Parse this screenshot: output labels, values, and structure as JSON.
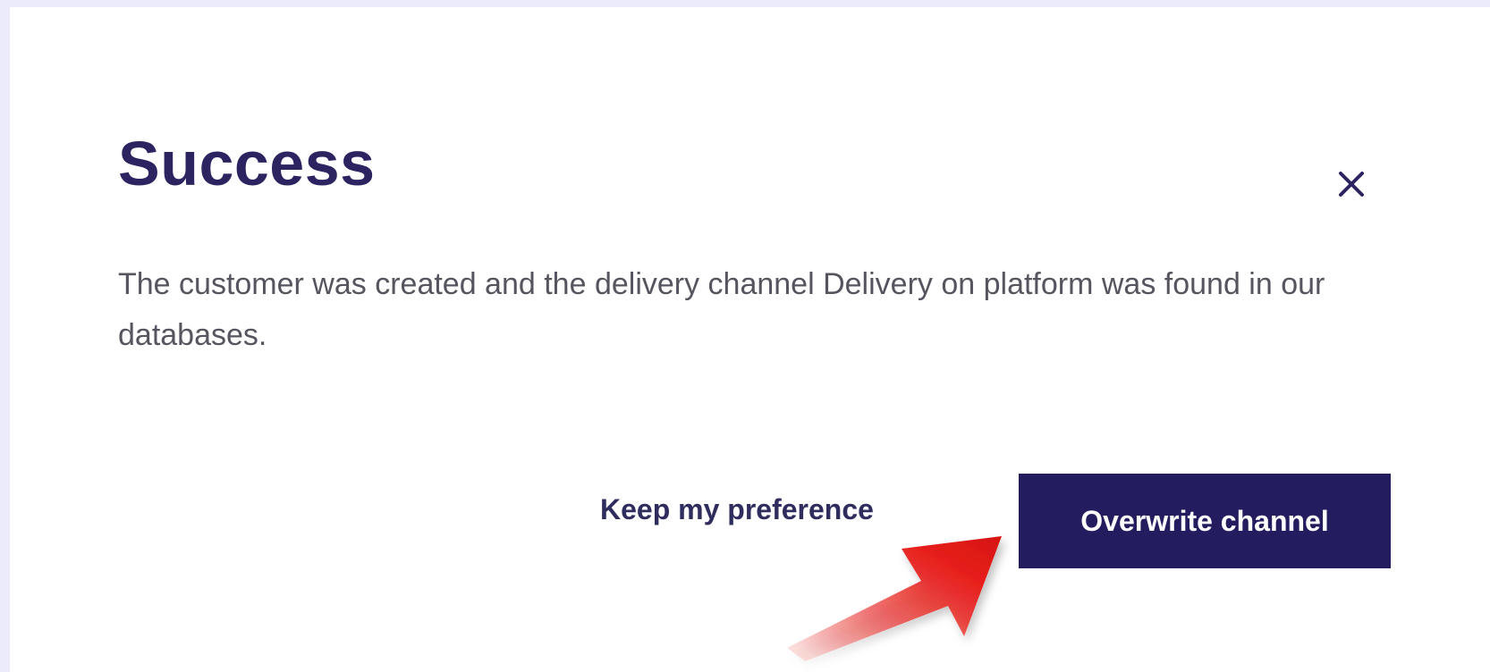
{
  "dialog": {
    "title": "Success",
    "message": "The customer was created and the delivery channel Delivery on platform was found in our databases.",
    "close_icon": "close-icon",
    "secondary_action_label": "Keep my preference",
    "primary_action_label": "Overwrite channel"
  },
  "annotation": {
    "icon": "red-arrow-pointer",
    "color": "#e8201c"
  },
  "colors": {
    "background": "#ecebfb",
    "title": "#2b2461",
    "primary_button": "#231c5f",
    "body_text": "#55555f"
  }
}
